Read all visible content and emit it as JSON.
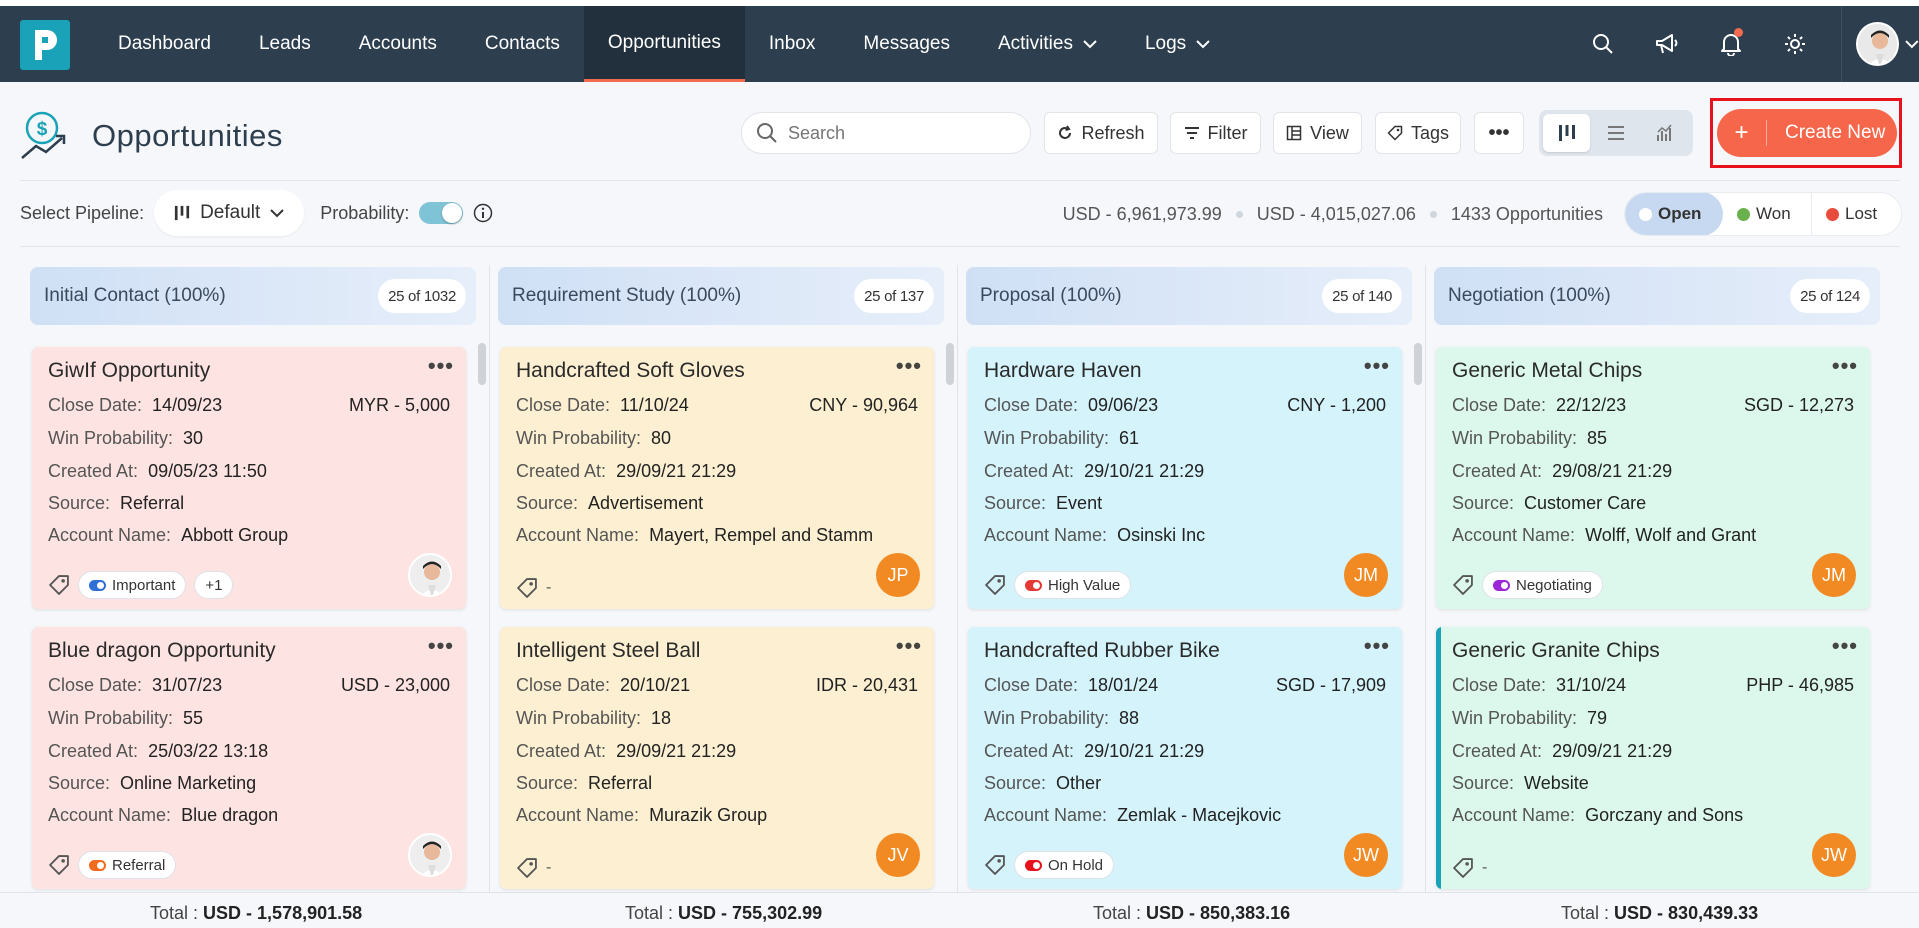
{
  "nav": {
    "items": [
      {
        "label": "Dashboard",
        "name": "nav-dashboard"
      },
      {
        "label": "Leads",
        "name": "nav-leads"
      },
      {
        "label": "Accounts",
        "name": "nav-accounts"
      },
      {
        "label": "Contacts",
        "name": "nav-contacts"
      },
      {
        "label": "Opportunities",
        "name": "nav-opportunities"
      },
      {
        "label": "Inbox",
        "name": "nav-inbox"
      },
      {
        "label": "Messages",
        "name": "nav-messages"
      },
      {
        "label": "Activities",
        "name": "nav-activities"
      },
      {
        "label": "Logs",
        "name": "nav-logs"
      }
    ],
    "active_color": "#f26b4f",
    "bg_color": "#2d3e4e"
  },
  "page": {
    "title": "Opportunities"
  },
  "toolbar": {
    "search_placeholder": "Search",
    "refresh": "Refresh",
    "filter": "Filter",
    "view": "View",
    "tags": "Tags",
    "create_new": "Create New",
    "create_color": "#f6664a"
  },
  "pipeline": {
    "label": "Select Pipeline:",
    "selected": "Default",
    "probability_label": "Probability:",
    "probability_on": true
  },
  "stats": {
    "total_amount": "USD - 6,961,973.99",
    "weighted_amount": "USD - 4,015,027.06",
    "count": "1433 Opportunities"
  },
  "status_filter": {
    "open": "Open",
    "won": "Won",
    "lost": "Lost",
    "open_color": "#c7d9f0",
    "won_color": "#6ab04c",
    "lost_color": "#e74c3c"
  },
  "columns": [
    {
      "title": "Initial Contact (100%)",
      "count": "25 of 1032",
      "total_label": "Total :",
      "total": "USD - 1,578,901.58",
      "cards": [
        {
          "title": "GiwIf Opportunity",
          "close_label": "Close Date:",
          "close": "14/09/23",
          "amount": "MYR - 5,000",
          "prob_label": "Win Probability:",
          "prob": "30",
          "created_label": "Created At:",
          "created": "09/05/23 11:50",
          "source_label": "Source:",
          "source": "Referral",
          "account_label": "Account Name:",
          "account": "Abbott Group",
          "tag": "Important",
          "tag_color": "#2f6fd6",
          "extra": "+1",
          "owner": "",
          "bg": "#fde3e1"
        },
        {
          "title": "Blue dragon Opportunity",
          "close_label": "Close Date:",
          "close": "31/07/23",
          "amount": "USD - 23,000",
          "prob_label": "Win Probability:",
          "prob": "55",
          "created_label": "Created At:",
          "created": "25/03/22 13:18",
          "source_label": "Source:",
          "source": "Online Marketing",
          "account_label": "Account Name:",
          "account": "Blue dragon",
          "tag": "Referral",
          "tag_color": "#f26b1f",
          "extra": "",
          "owner": "",
          "bg": "#fde3e1"
        }
      ]
    },
    {
      "title": "Requirement Study (100%)",
      "count": "25 of 137",
      "total_label": "Total :",
      "total": "USD - 755,302.99",
      "cards": [
        {
          "title": "Handcrafted Soft Gloves",
          "close_label": "Close Date:",
          "close": "11/10/24",
          "amount": "CNY - 90,964",
          "prob_label": "Win Probability:",
          "prob": "80",
          "created_label": "Created At:",
          "created": "29/09/21 21:29",
          "source_label": "Source:",
          "source": "Advertisement",
          "account_label": "Account Name:",
          "account": "Mayert, Rempel and Stamm",
          "tag": "-",
          "tag_color": "",
          "extra": "",
          "owner": "JP",
          "bg": "#fdf0d2"
        },
        {
          "title": "Intelligent Steel Ball",
          "close_label": "Close Date:",
          "close": "20/10/21",
          "amount": "IDR - 20,431",
          "prob_label": "Win Probability:",
          "prob": "18",
          "created_label": "Created At:",
          "created": "29/09/21 21:29",
          "source_label": "Source:",
          "source": "Referral",
          "account_label": "Account Name:",
          "account": "Murazik Group",
          "tag": "-",
          "tag_color": "",
          "extra": "",
          "owner": "JV",
          "bg": "#fdf0d2"
        }
      ]
    },
    {
      "title": "Proposal (100%)",
      "count": "25 of 140",
      "total_label": "Total :",
      "total": "USD - 850,383.16",
      "cards": [
        {
          "title": "Hardware Haven",
          "close_label": "Close Date:",
          "close": "09/06/23",
          "amount": "CNY - 1,200",
          "prob_label": "Win Probability:",
          "prob": "61",
          "created_label": "Created At:",
          "created": "29/10/21 21:29",
          "source_label": "Source:",
          "source": "Event",
          "account_label": "Account Name:",
          "account": "Osinski Inc",
          "tag": "High Value",
          "tag_color": "#e53935",
          "extra": "",
          "owner": "JM",
          "bg": "#d5f3fb"
        },
        {
          "title": "Handcrafted Rubber Bike",
          "close_label": "Close Date:",
          "close": "18/01/24",
          "amount": "SGD - 17,909",
          "prob_label": "Win Probability:",
          "prob": "88",
          "created_label": "Created At:",
          "created": "29/10/21 21:29",
          "source_label": "Source:",
          "source": "Other",
          "account_label": "Account Name:",
          "account": "Zemlak - Macejkovic",
          "tag": "On Hold",
          "tag_color": "#e8121c",
          "extra": "",
          "owner": "JW",
          "bg": "#d5f3fb"
        }
      ]
    },
    {
      "title": "Negotiation (100%)",
      "count": "25 of 124",
      "total_label": "Total :",
      "total": "USD - 830,439.33",
      "cards": [
        {
          "title": "Generic Metal Chips",
          "close_label": "Close Date:",
          "close": "22/12/23",
          "amount": "SGD - 12,273",
          "prob_label": "Win Probability:",
          "prob": "85",
          "created_label": "Created At:",
          "created": "29/08/21 21:29",
          "source_label": "Source:",
          "source": "Customer Care",
          "account_label": "Account Name:",
          "account": "Wolff, Wolf and Grant",
          "tag": "Negotiating",
          "tag_color": "#9c27d6",
          "extra": "",
          "owner": "JM",
          "bg": "#dcf8ec"
        },
        {
          "title": "Generic Granite Chips",
          "close_label": "Close Date:",
          "close": "31/10/24",
          "amount": "PHP - 46,985",
          "prob_label": "Win Probability:",
          "prob": "79",
          "created_label": "Created At:",
          "created": "29/09/21 21:29",
          "source_label": "Source:",
          "source": "Website",
          "account_label": "Account Name:",
          "account": "Gorczany and Sons",
          "tag": "-",
          "tag_color": "",
          "extra": "",
          "owner": "JW",
          "bg": "#dcf8ec"
        }
      ]
    }
  ]
}
